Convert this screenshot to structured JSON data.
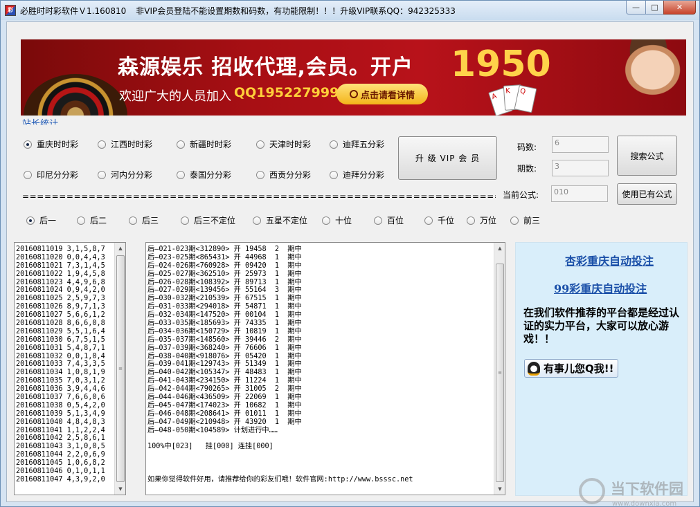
{
  "window": {
    "app_title": "必胜时时彩软件Ｖ1.160810",
    "notice": "非VIP会员登陆不能设置期数和码数，有功能限制！！！升级VIP联系QQ：942325333",
    "icon_text": "彩"
  },
  "banner": {
    "title": "森源娱乐 招收代理,会员。开户",
    "number": "1950",
    "sub": "欢迎广大的人员加入",
    "qq": "QQ1952279999",
    "button": "点击请看详情"
  },
  "stat_link": "站长统计",
  "lotteries": [
    {
      "label": "重庆时时彩",
      "selected": true
    },
    {
      "label": "江西时时彩",
      "selected": false
    },
    {
      "label": "新疆时时彩",
      "selected": false
    },
    {
      "label": "天津时时彩",
      "selected": false
    },
    {
      "label": "迪拜五分彩",
      "selected": false
    },
    {
      "label": "印尼分分彩",
      "selected": false
    },
    {
      "label": "河内分分彩",
      "selected": false
    },
    {
      "label": "泰国分分彩",
      "selected": false
    },
    {
      "label": "西贡分分彩",
      "selected": false
    },
    {
      "label": "迪拜分分彩",
      "selected": false
    }
  ],
  "separator": "======================================================================",
  "upgrade_button": "升 级 VIP 会 员",
  "fields": {
    "code_count_label": "码数:",
    "code_count_value": "6",
    "period_label": "期数:",
    "period_value": "3",
    "formula_label": "当前公式:",
    "formula_value": "010"
  },
  "search_button": "搜索公式",
  "use_formula_button": "使用已有公式",
  "positions": [
    {
      "label": "后一",
      "selected": true
    },
    {
      "label": "后二",
      "selected": false
    },
    {
      "label": "后三",
      "selected": false
    },
    {
      "label": "后三不定位",
      "selected": false
    },
    {
      "label": "五星不定位",
      "selected": false
    },
    {
      "label": "十位",
      "selected": false
    },
    {
      "label": "百位",
      "selected": false
    },
    {
      "label": "千位",
      "selected": false
    },
    {
      "label": "万位",
      "selected": false
    },
    {
      "label": "前三",
      "selected": false
    }
  ],
  "history": [
    "20160811019 3,1,5,8,7",
    "20160811020 0,0,4,4,3",
    "20160811021 7,3,1,4,5",
    "20160811022 1,9,4,5,8",
    "20160811023 4,4,9,6,8",
    "20160811024 0,9,4,2,0",
    "20160811025 2,5,9,7,3",
    "20160811026 8,9,7,1,3",
    "20160811027 5,6,6,1,2",
    "20160811028 8,6,6,0,8",
    "20160811029 5,5,1,6,4",
    "20160811030 6,7,5,1,5",
    "20160811031 5,4,8,7,1",
    "20160811032 0,0,1,0,4",
    "20160811033 7,4,3,3,5",
    "20160811034 1,0,8,1,9",
    "20160811035 7,0,3,1,2",
    "20160811036 3,9,4,4,6",
    "20160811037 7,6,6,0,6",
    "20160811038 0,5,4,2,0",
    "20160811039 5,1,3,4,9",
    "20160811040 4,8,4,8,3",
    "20160811041 1,1,2,2,4",
    "20160811042 2,5,8,6,1",
    "20160811043 3,1,0,0,5",
    "20160811044 2,2,0,6,9",
    "20160811045 1,0,6,8,2",
    "20160811046 0,1,0,1,1",
    "20160811047 4,3,9,2,0"
  ],
  "plan_lines": [
    "后—021-023期<312890> 开 19458  2  期中",
    "后—023-025期<865431> 开 44968  1  期中",
    "后—024-026期<760928> 开 09420  1  期中",
    "后—025-027期<362510> 开 25973  1  期中",
    "后—026-028期<108392> 开 89713  1  期中",
    "后—027-029期<139456> 开 55164  3  期中",
    "后—030-032期<210539> 开 67515  1  期中",
    "后—031-033期<294018> 开 54871  1  期中",
    "后—032-034期<147520> 开 00104  1  期中",
    "后—033-035期<185693> 开 74335  1  期中",
    "后—034-036期<150729> 开 10819  1  期中",
    "后—035-037期<148560> 开 39446  2  期中",
    "后—037-039期<368240> 开 76606  1  期中",
    "后—038-040期<918076> 开 05420  1  期中",
    "后—039-041期<129743> 开 51349  1  期中",
    "后—040-042期<105347> 开 48483  1  期中",
    "后—041-043期<234150> 开 11224  1  期中",
    "后—042-044期<790265> 开 31005  2  期中",
    "后—044-046期<436509> 开 22069  1  期中",
    "后—045-047期<174023> 开 10682  1  期中",
    "后—046-048期<208641> 开 01011  1  期中",
    "后—047-049期<210948> 开 43920  1  期中",
    "后—048-050期<104589> 计划进行中……",
    "",
    "100%中[023]   挂[000] 连挂[000]",
    "",
    "",
    "",
    "如果你觉得软件好用，请推荐给你的彩友们哦！软件官网:http://www.bsssc.net"
  ],
  "right_panel": {
    "link1": "杏彩重庆自动投注",
    "link2": "99彩重庆自动投注",
    "text": "在我们软件推荐的平台都是经过认证的实力平台，大家可以放心游戏！！",
    "qq_button": "有事儿您Q我!!"
  },
  "watermark": {
    "text": "当下软件园",
    "url": "www.downxia.com"
  }
}
